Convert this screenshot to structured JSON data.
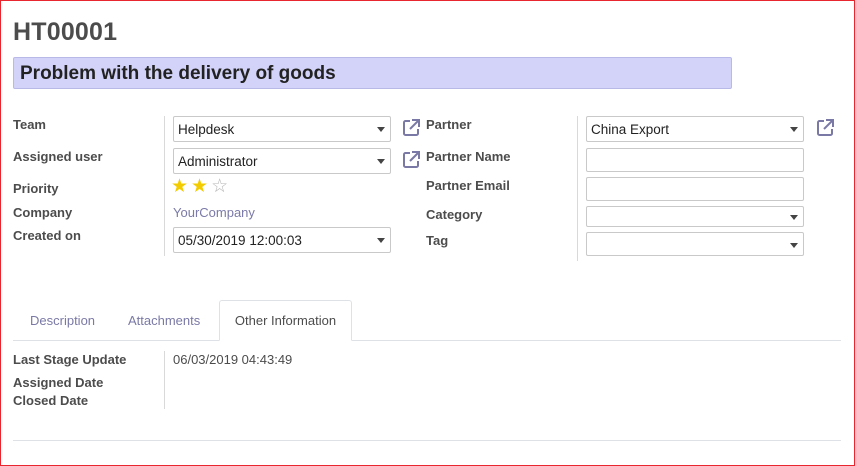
{
  "ticket": {
    "reference": "HT00001",
    "subject": "Problem with the delivery of goods"
  },
  "left": {
    "team_label": "Team",
    "team_value": "Helpdesk",
    "assigned_user_label": "Assigned user",
    "assigned_user_value": "Administrator",
    "priority_label": "Priority",
    "priority_value": 2,
    "priority_max": 3,
    "company_label": "Company",
    "company_value": "YourCompany",
    "created_on_label": "Created on",
    "created_on_value": "05/30/2019 12:00:03"
  },
  "right": {
    "partner_label": "Partner",
    "partner_value": "China Export",
    "partner_name_label": "Partner Name",
    "partner_name_value": "",
    "partner_email_label": "Partner Email",
    "partner_email_value": "",
    "category_label": "Category",
    "category_value": "",
    "tag_label": "Tag",
    "tag_value": ""
  },
  "tabs": [
    {
      "label": "Description"
    },
    {
      "label": "Attachments"
    },
    {
      "label": "Other Information",
      "active": true
    }
  ],
  "other_info": {
    "last_stage_update_label": "Last Stage Update",
    "last_stage_update_value": "06/03/2019 04:43:49",
    "assigned_date_label": "Assigned Date",
    "assigned_date_value": "",
    "closed_date_label": "Closed Date",
    "closed_date_value": ""
  },
  "colors": {
    "subject_bg": "#d3d3f9",
    "star_on": "#f3cc00",
    "star_off": "#b5b5b5",
    "link": "#7a79a6",
    "frame": "#e8262f"
  },
  "icons": {
    "external": "external-link-icon",
    "dropdown": "caret-down-icon",
    "star": "star-icon"
  }
}
